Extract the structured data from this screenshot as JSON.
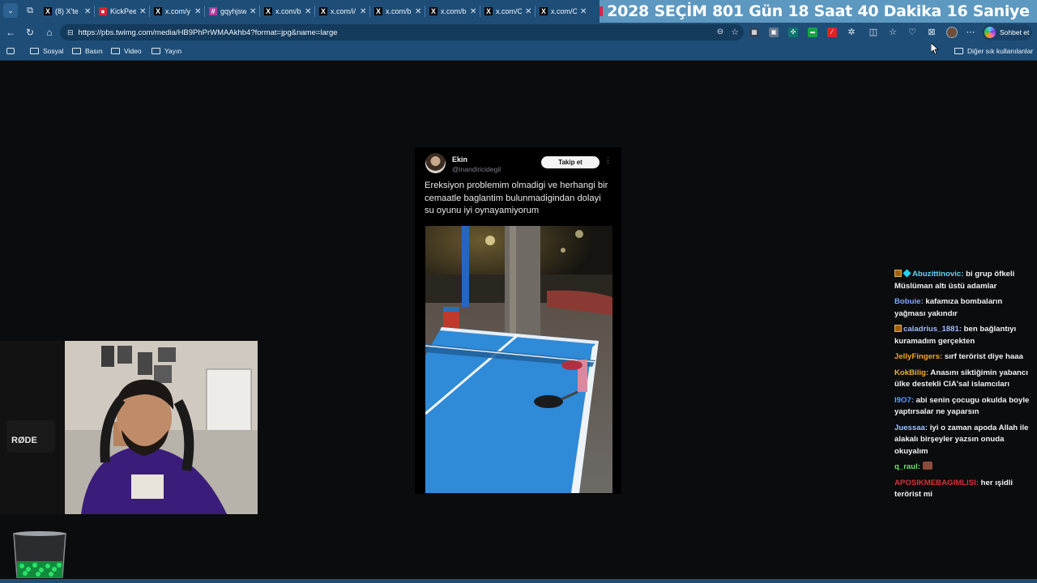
{
  "browser": {
    "tabs": [
      {
        "favicon": "x-icon",
        "title": "(8) X'te"
      },
      {
        "favicon": "kick-icon",
        "title": "KickPee"
      },
      {
        "favicon": "x-icon",
        "title": "x.com/y"
      },
      {
        "favicon": "hash-icon",
        "title": "gqyhjsw"
      },
      {
        "favicon": "x-icon",
        "title": "x.com/b"
      },
      {
        "favicon": "x-icon",
        "title": "x.com/i/"
      },
      {
        "favicon": "x-icon",
        "title": "x.com/b"
      },
      {
        "favicon": "x-icon",
        "title": "x.com/b"
      },
      {
        "favicon": "x-icon",
        "title": "x.com/C"
      },
      {
        "favicon": "x-icon",
        "title": "x.com/C"
      }
    ],
    "url": "https://pbs.twimg.com/media/HB9PhPrWMAAkhb4?format=jpg&name=large",
    "copilot_label": "Sohbet et",
    "bookmarks": [
      "Sosyal",
      "Basın",
      "Video",
      "Yayın"
    ],
    "other_bookmarks": "Diğer sık kullanılanlar"
  },
  "countdown": {
    "year": "2028",
    "label": "SEÇİM",
    "days": "801 Gün",
    "hours": "18 Saat",
    "minutes": "40 Dakika",
    "seconds": "16 Saniye"
  },
  "tweet": {
    "name": "Ekin",
    "handle": "@inandiricidegil",
    "follow_label": "Takip et",
    "text": "Ereksiyon problemim olmadigi ve herhangi bir cemaatle baglantim bulunmadigindan dolayi su oyunu iyi oynayamiyorum"
  },
  "chat": [
    {
      "user": "Abuzittinovic",
      "color": "#5fd4f5",
      "badges": [
        "sub",
        "diamond"
      ],
      "text": " bi grup öfkeli Müslüman altı üstü adamlar"
    },
    {
      "user": "Bobuie",
      "color": "#7aa7ff",
      "badges": [],
      "text": " kafamıza bombaların yağması yakındır"
    },
    {
      "user": "caladrius_1881",
      "color": "#9fb9ff",
      "badges": [
        "sub"
      ],
      "text": " ben bağlantıyı kuramadım gerçekten"
    },
    {
      "user": "JellyFingers",
      "color": "#f5a623",
      "badges": [],
      "text": " sırf terörist diye haaa"
    },
    {
      "user": "KokBilig",
      "color": "#f0b030",
      "badges": [],
      "text": " Anasını siktiğimin yabancı ülke destekli CIA'sal islamcıları"
    },
    {
      "user": "I9O7",
      "color": "#5c9cff",
      "badges": [],
      "text": " abi senin çocugu okulda boyle yaptırsalar ne yaparsın"
    },
    {
      "user": "Juessaa",
      "color": "#9ec4ff",
      "badges": [],
      "text": " iyi o zaman apoda Allah ile alakalı birşeyler yazsın onuda okuyalım"
    },
    {
      "user": "q_raul",
      "color": "#6ee06e",
      "badges": [],
      "text": " ",
      "emote": true
    },
    {
      "user": "APOSIKMEBAGIMLISI",
      "color": "#d9303a",
      "badges": [],
      "text": " her ışidli terörist mi"
    }
  ]
}
